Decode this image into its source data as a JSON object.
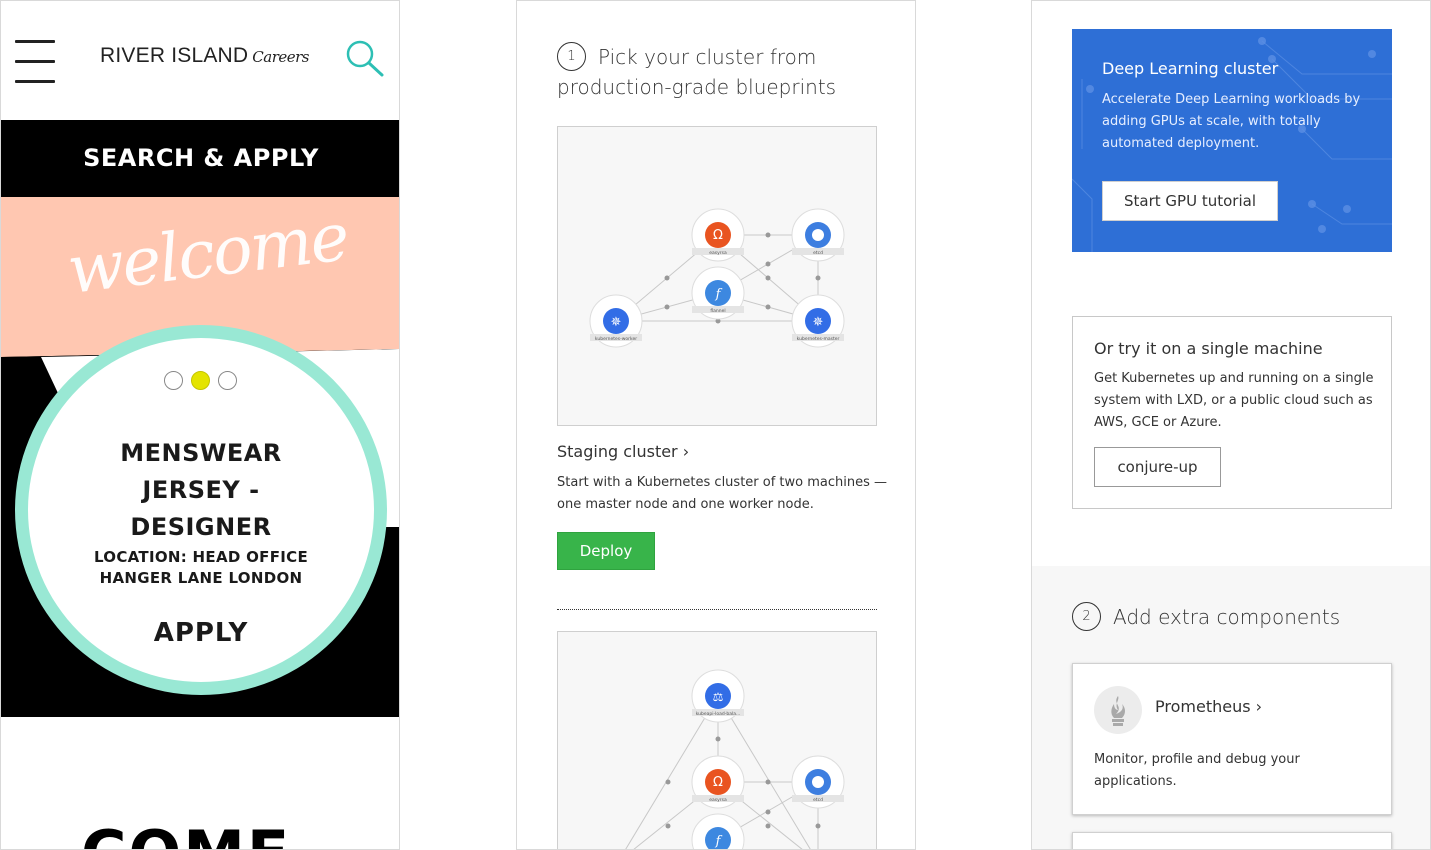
{
  "river_island": {
    "logo_text": "RIVER ISLAND",
    "logo_sub": "Careers",
    "banner_title": "SEARCH & APPLY",
    "welcome_script": "welcome",
    "carousel": {
      "total": 3,
      "active_index": 1
    },
    "job": {
      "title_line1": "MENSWEAR",
      "title_line2": "JERSEY -",
      "title_line3": "DESIGNER",
      "location_line1": "LOCATION: HEAD OFFICE",
      "location_line2": "HANGER LANE LONDON",
      "apply_label": "APPLY"
    },
    "bottom_heading": "COME",
    "colors": {
      "peach": "#ffc7b1",
      "mint": "#99e8d4",
      "active_dot": "#e4e400"
    }
  },
  "kubernetes": {
    "step1": {
      "number": "1",
      "heading": "Pick your cluster from production-grade blueprints"
    },
    "staging": {
      "link": "Staging cluster ›",
      "description": "Start with a Kubernetes cluster of two machines — one master node and one worker node.",
      "deploy_label": "Deploy"
    },
    "diagram1_nodes": [
      "easyrsa",
      "etcd",
      "flannel",
      "kubernetes-worker",
      "kubernetes-master"
    ],
    "diagram2_nodes": [
      "kubeapi-load-bala...",
      "easyrsa",
      "etcd",
      "flannel"
    ],
    "gpu": {
      "title": "Deep Learning cluster",
      "description": "Accelerate Deep Learning workloads by adding GPUs at scale, with totally automated deployment.",
      "button": "Start GPU tutorial"
    },
    "single": {
      "title": "Or try it on a single machine",
      "description": "Get Kubernetes up and running on a single system with LXD, or a public cloud such as AWS, GCE or Azure.",
      "button": "conjure-up"
    },
    "step2": {
      "number": "2",
      "heading": "Add extra components"
    },
    "prometheus": {
      "link": "Prometheus ›",
      "description": "Monitor, profile and debug your applications."
    },
    "colors": {
      "deploy_green": "#38b44a",
      "gpu_blue": "#2e6fd6",
      "grey_bg": "#f7f7f7"
    }
  }
}
